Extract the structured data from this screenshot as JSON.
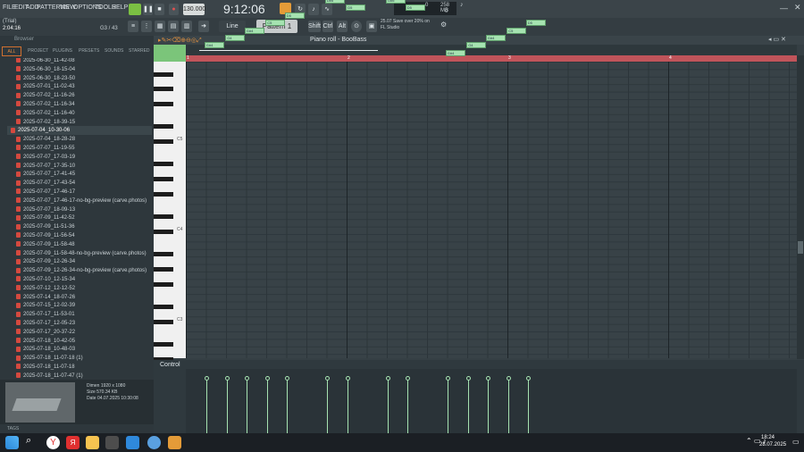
{
  "menu": [
    "FILE",
    "EDIT",
    "ADD",
    "PATTERNS",
    "VIEW",
    "OPTIONS",
    "TOOLS",
    "HELP"
  ],
  "transport": {
    "tempo": "130.000",
    "time": "9:12:06",
    "pattern": "Pattern 1",
    "ram": "258 MB",
    "cpu": "0",
    "voices": "0"
  },
  "hint": {
    "line1": "25.07  Save over 20% on",
    "line2": "FL Studio"
  },
  "status": {
    "trial": "(Trial)",
    "time": "2:04:16",
    "count": "G3 / 43"
  },
  "browser": {
    "title": "Browser",
    "tabs": [
      "ALL",
      "PROJECT",
      "PLUGINS",
      "PRESETS",
      "SOUNDS",
      "STARRED"
    ],
    "files": [
      "2025-06-30_11-42-08",
      "2025-06-30_18-15-04",
      "2025-06-30_18-23-50",
      "2025-07-01_11-02-43",
      "2025-07-02_11-16-26",
      "2025-07-02_11-16-34",
      "2025-07-02_11-16-40",
      "2025-07-02_18-39-15",
      "2025-07-04_10-30-06",
      "2025-07-04_18-28-28",
      "2025-07-07_11-19-55",
      "2025-07-07_17-03-19",
      "2025-07-07_17-35-10",
      "2025-07-07_17-41-45",
      "2025-07-07_17-43-54",
      "2025-07-07_17-46-17",
      "2025-07-07_17-46-17-no-bg-preview (carve.photos)",
      "2025-07-07_18-09-13",
      "2025-07-09_11-42-52",
      "2025-07-09_11-51-36",
      "2025-07-09_11-56-54",
      "2025-07-09_11-58-48",
      "2025-07-09_11-58-48-no-bg-preview (carve.photos)",
      "2025-07-09_12-26-34",
      "2025-07-09_12-26-34-no-bg-preview (carve.photos)",
      "2025-07-10_12-15-34",
      "2025-07-12_12-12-52",
      "2025-07-14_18-07-26",
      "2025-07-15_12-02-39",
      "2025-07-17_11-53-01",
      "2025-07-17_12-05-23",
      "2025-07-17_20-37-22",
      "2025-07-18_10-42-05",
      "2025-07-18_10-48-03",
      "2025-07-18_11-07-18 (1)",
      "2025-07-18_11-07-18",
      "2025-07-18_11-07-47 (1)"
    ],
    "selected_index": 8,
    "preview": {
      "dims": "Dimen  1920 x 1080",
      "size": "Size   570.34 KB",
      "date": "Date   04.07.2025 10:30:08"
    },
    "tags": "TAGS"
  },
  "pianoroll": {
    "title": "Piano roll - BooBass",
    "snap": "Line",
    "octaves": [
      "C5",
      "C4",
      "C3"
    ],
    "bars": [
      "1",
      "2",
      "3",
      "4"
    ],
    "control": "Control",
    "notes": [
      {
        "label": "G#4",
        "bar": 1.06,
        "row": 40
      },
      {
        "label": "G4",
        "bar": 1.19,
        "row": 41
      },
      {
        "label": "G#4",
        "bar": 1.31,
        "row": 42
      },
      {
        "label": "C5",
        "bar": 1.44,
        "row": 43
      },
      {
        "label": "D5",
        "bar": 1.56,
        "row": 44
      },
      {
        "label": "D#5",
        "bar": 1.81,
        "row": 46
      },
      {
        "label": "D5",
        "bar": 1.94,
        "row": 45
      },
      {
        "label": "D#5",
        "bar": 2.19,
        "row": 46
      },
      {
        "label": "D5",
        "bar": 2.31,
        "row": 45
      },
      {
        "label": "G#4",
        "bar": 2.56,
        "row": 39
      },
      {
        "label": "G4",
        "bar": 2.69,
        "row": 40
      },
      {
        "label": "G#4",
        "bar": 2.81,
        "row": 41
      },
      {
        "label": "C5",
        "bar": 2.94,
        "row": 42
      },
      {
        "label": "D5",
        "bar": 3.06,
        "row": 43
      }
    ]
  },
  "clock": {
    "time": "18:24",
    "date": "28.07.2025"
  }
}
